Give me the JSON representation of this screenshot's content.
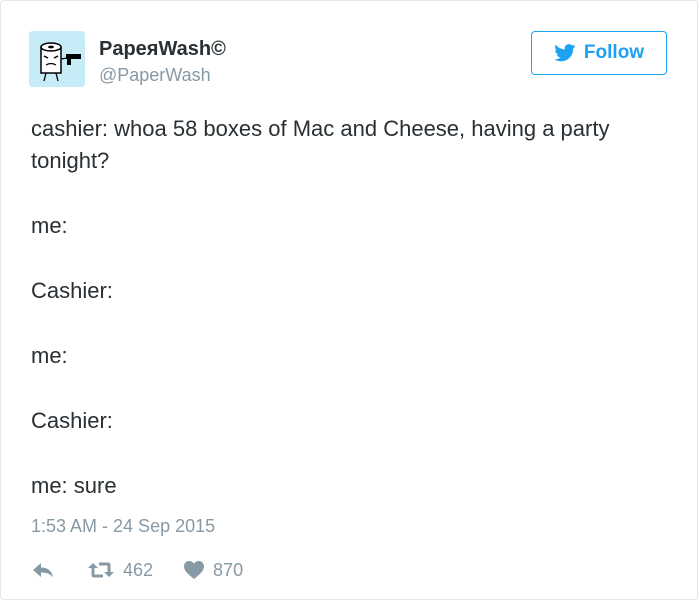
{
  "user": {
    "display_name": "PaperWash©",
    "display_name_rendered": "PapeяWash©",
    "screen_name": "@PaperWash"
  },
  "follow_button": {
    "label": "Follow",
    "icon": "twitter-bird-icon"
  },
  "tweet": {
    "lines": [
      "cashier: whoa 58 boxes of Mac and Cheese, having a party",
      "tonight?",
      "",
      "me:",
      "",
      "Cashier:",
      "",
      "me:",
      "",
      "Cashier:",
      "",
      "me: sure"
    ],
    "timestamp": "1:53 AM - 24 Sep 2015"
  },
  "actions": {
    "reply_icon": "reply-icon",
    "retweet_icon": "retweet-icon",
    "retweet_count": "462",
    "like_icon": "heart-icon",
    "like_count": "870"
  },
  "colors": {
    "accent": "#1da1f2",
    "text": "#292f33",
    "muted": "#8899a6",
    "avatar_bg": "#c6ecf8"
  }
}
